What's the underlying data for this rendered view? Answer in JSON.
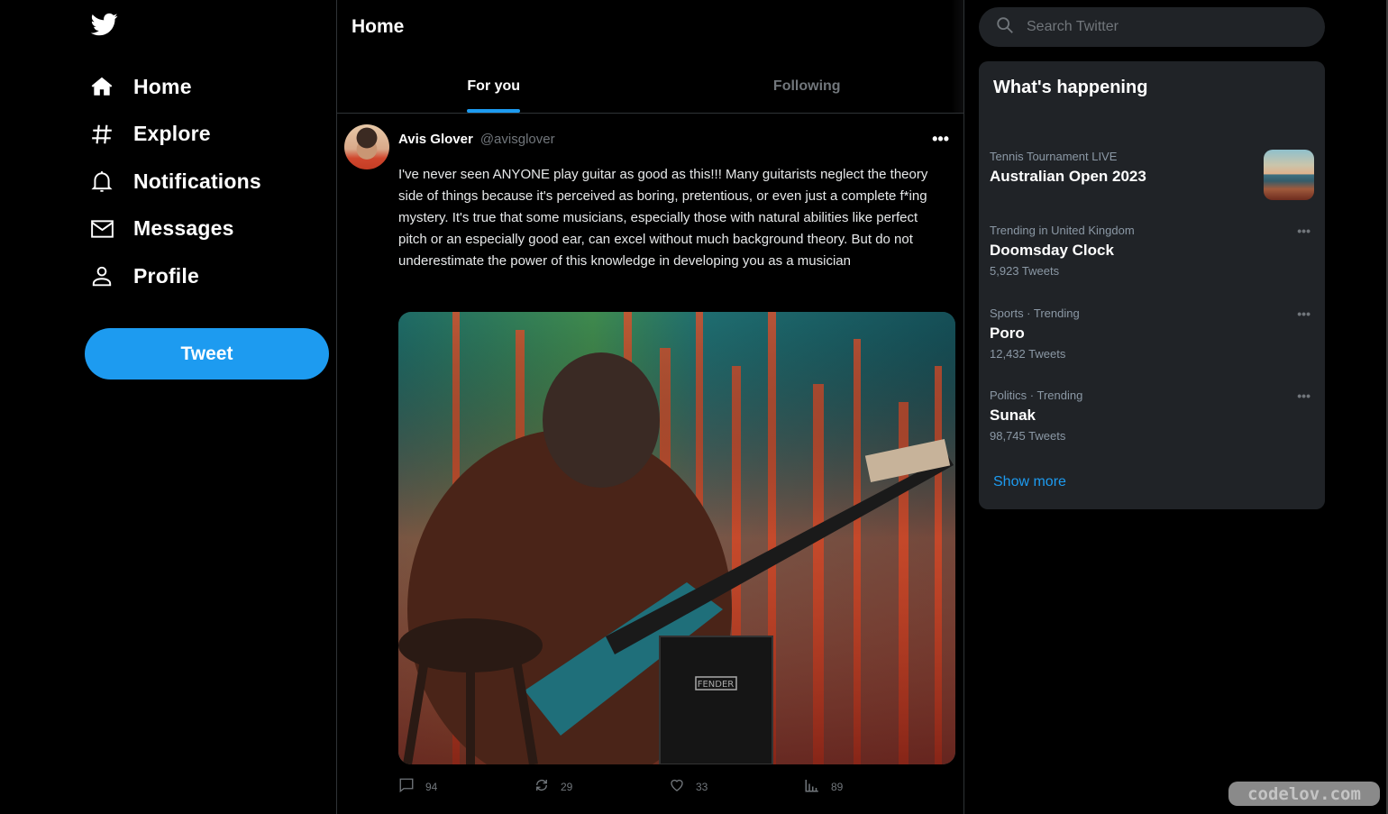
{
  "sidebar": {
    "logo": "twitter-bird-icon",
    "items": [
      {
        "label": "Home",
        "icon": "home-icon"
      },
      {
        "label": "Explore",
        "icon": "hashtag-icon"
      },
      {
        "label": "Notifications",
        "icon": "bell-icon"
      },
      {
        "label": "Messages",
        "icon": "envelope-icon"
      },
      {
        "label": "Profile",
        "icon": "user-icon"
      }
    ],
    "tweet_button": "Tweet"
  },
  "main": {
    "title": "Home",
    "tabs": [
      {
        "label": "For you",
        "active": true
      },
      {
        "label": "Following",
        "active": false
      }
    ],
    "tweet": {
      "name": "Avis Glover",
      "handle": "@avisglover",
      "more": "•••",
      "text": "I've never seen ANYONE play guitar as good as this!!! Many guitarists neglect the theory side of things because it's perceived as boring, pretentious, or even just a complete f*ing mystery. It's true that some musicians, especially those with natural abilities like perfect pitch or an especially good ear, can excel without much background theory. But do not underestimate the power of this knowledge in developing you as a musician",
      "media_description": "Chimpanzee playing a teal electric guitar on a stool in front of a red and green curtain with a Fender amplifier",
      "amp_label": "FENDER",
      "actions": {
        "replies": "94",
        "retweets": "29",
        "likes": "33",
        "views": "89"
      }
    }
  },
  "right": {
    "search_placeholder": "Search Twitter",
    "trends_title": "What's happening",
    "trends": [
      {
        "meta": "Tennis Tournament LIVE",
        "topic": "Australian Open 2023",
        "count": "",
        "has_image": true
      },
      {
        "meta": "Trending in United Kingdom",
        "topic": "Doomsday Clock",
        "count": "5,923 Tweets"
      },
      {
        "meta": "Sports · Trending",
        "topic": "Poro",
        "count": "12,432 Tweets"
      },
      {
        "meta": "Politics · Trending",
        "topic": "Sunak",
        "count": "98,745 Tweets"
      }
    ],
    "dots": "•••",
    "show_more": "Show more"
  },
  "watermark": "codelov.com",
  "colors": {
    "accent": "#1d9bf0",
    "background": "#000000",
    "card": "#202327",
    "muted": "#71767b"
  }
}
